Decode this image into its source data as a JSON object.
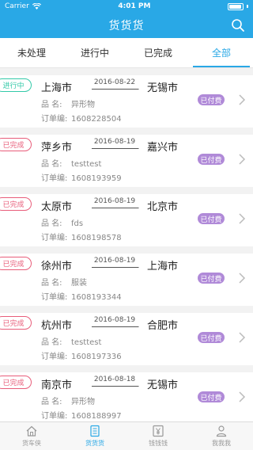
{
  "status_bar": {
    "carrier": "Carrier",
    "time": "4:01 PM"
  },
  "header": {
    "title": "货货货",
    "search_icon": "search-icon"
  },
  "tabs": [
    {
      "label": "未处理",
      "active": false
    },
    {
      "label": "进行中",
      "active": false
    },
    {
      "label": "已完成",
      "active": false
    },
    {
      "label": "全部",
      "active": true
    }
  ],
  "orders": [
    {
      "status": "进行中",
      "status_type": "inprogress",
      "from": "上海市",
      "date": "2016-08-22",
      "to": "无锡市",
      "goods_label": "品  名:",
      "goods": "异形物",
      "order_label": "订单编:",
      "order_no": "1608228504",
      "payment": "已付费"
    },
    {
      "status": "已完成",
      "status_type": "done",
      "from": "萍乡市",
      "date": "2016-08-19",
      "to": "嘉兴市",
      "goods_label": "品  名:",
      "goods": "testtest",
      "order_label": "订单编:",
      "order_no": "1608193959",
      "payment": "已付费"
    },
    {
      "status": "已完成",
      "status_type": "done",
      "from": "太原市",
      "date": "2016-08-19",
      "to": "北京市",
      "goods_label": "品  名:",
      "goods": "fds",
      "order_label": "订单编:",
      "order_no": "1608198578",
      "payment": "已付费"
    },
    {
      "status": "已完成",
      "status_type": "done",
      "from": "徐州市",
      "date": "2016-08-19",
      "to": "上海市",
      "goods_label": "品  名:",
      "goods": "服装",
      "order_label": "订单编:",
      "order_no": "1608193344",
      "payment": "已付费"
    },
    {
      "status": "已完成",
      "status_type": "done",
      "from": "杭州市",
      "date": "2016-08-19",
      "to": "合肥市",
      "goods_label": "品  名:",
      "goods": "testtest",
      "order_label": "订单编:",
      "order_no": "1608197336",
      "payment": "已付费"
    },
    {
      "status": "已完成",
      "status_type": "done",
      "from": "南京市",
      "date": "2016-08-18",
      "to": "无锡市",
      "goods_label": "品  名:",
      "goods": "异形物",
      "order_label": "订单编:",
      "order_no": "1608188997",
      "payment": "已付费"
    }
  ],
  "bottom_nav": [
    {
      "label": "货车侠",
      "icon": "home-icon",
      "active": false
    },
    {
      "label": "货货货",
      "icon": "document-icon",
      "active": true
    },
    {
      "label": "钱钱钱",
      "icon": "yen-icon",
      "active": false
    },
    {
      "label": "我我我",
      "icon": "person-icon",
      "active": false
    }
  ],
  "colors": {
    "accent": "#29a8e6",
    "inprogress": "#33c9a8",
    "done": "#e85d7a",
    "paid": "#b08ad8"
  }
}
